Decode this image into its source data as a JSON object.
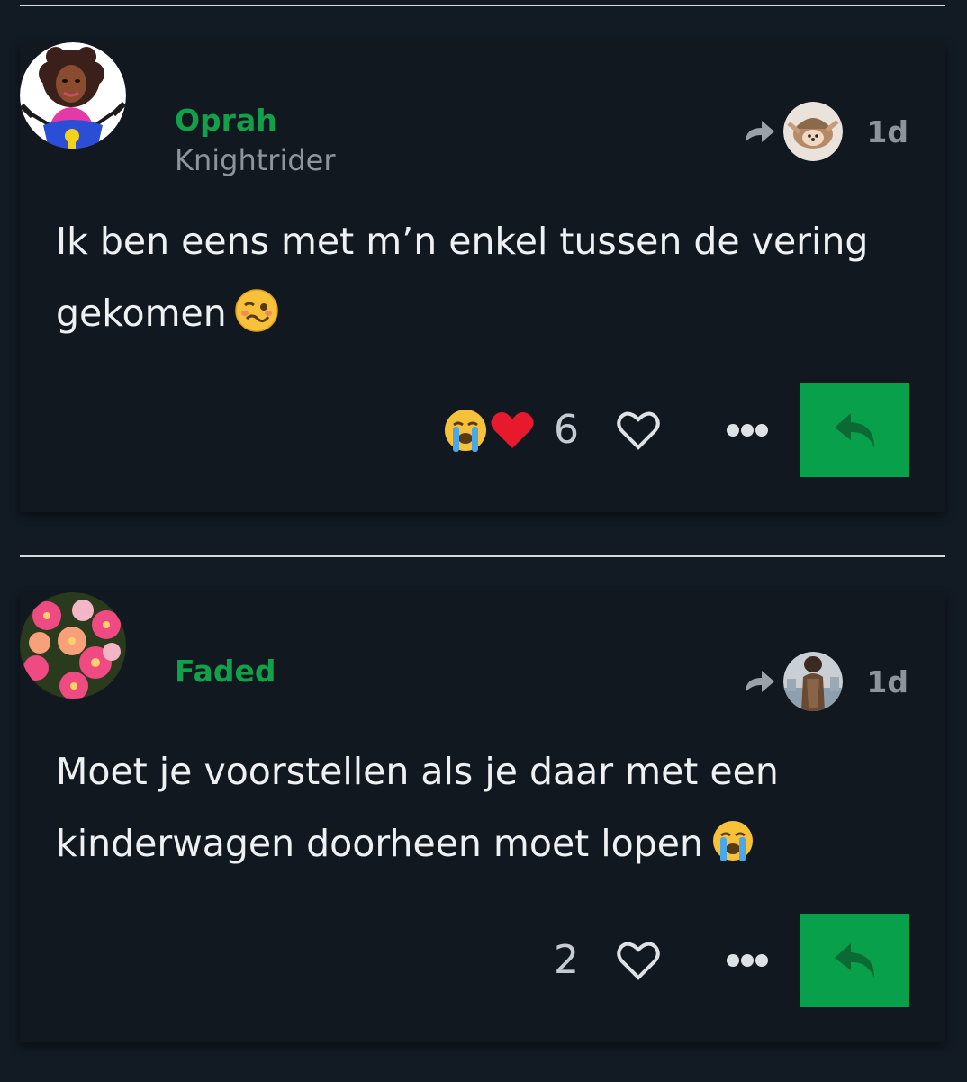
{
  "posts": [
    {
      "username": "Oprah",
      "user_title": "Knightrider",
      "date": "1d",
      "body_line1": "Ik ben eens met m’n enkel tussen de vering",
      "body_line2": "gekomen",
      "body_emoji": "woozy-face-icon",
      "reactions": [
        "crying-face-icon",
        "red-heart-icon"
      ],
      "like_count": "6"
    },
    {
      "username": "Faded",
      "user_title": "",
      "date": "1d",
      "body_line1": "Moet je voorstellen als je daar met een",
      "body_line2": "kinderwagen doorheen moet lopen",
      "body_emoji": "crying-face-icon",
      "reactions": [],
      "like_count": "2"
    }
  ],
  "colors": {
    "background": "#121a24",
    "card": "#111820",
    "username": "#12a04a",
    "reply_button": "#08a04a",
    "muted": "#8c949c"
  }
}
